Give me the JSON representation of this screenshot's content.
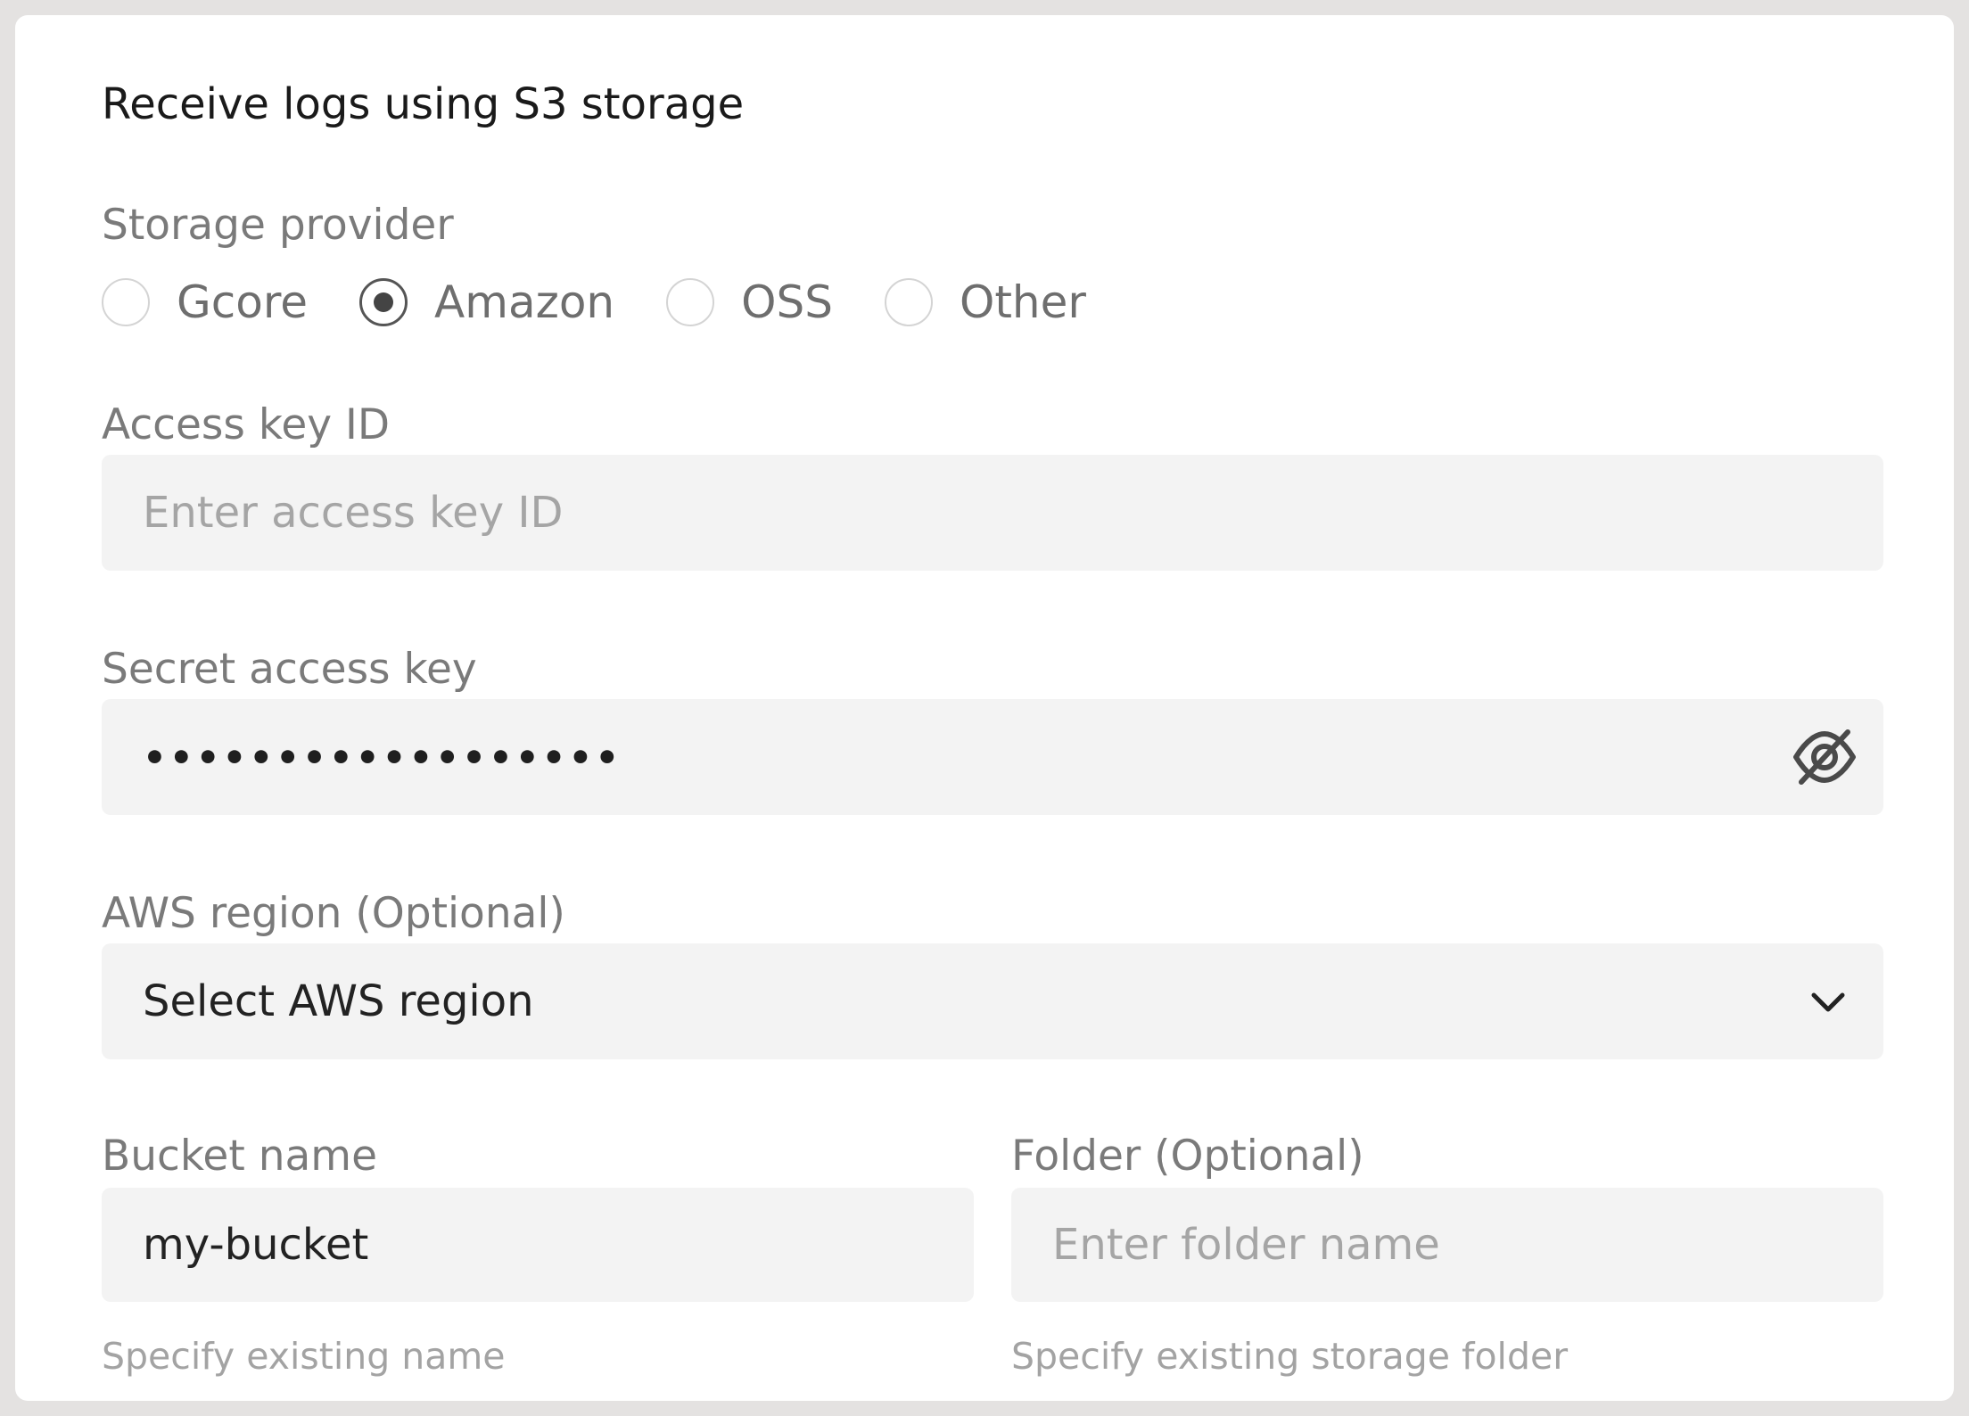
{
  "form": {
    "title": "Receive logs using S3 storage",
    "storage_provider": {
      "label": "Storage provider",
      "options": [
        {
          "label": "Gcore",
          "selected": false
        },
        {
          "label": "Amazon",
          "selected": true
        },
        {
          "label": "OSS",
          "selected": false
        },
        {
          "label": "Other",
          "selected": false
        }
      ]
    },
    "access_key_id": {
      "label": "Access key ID",
      "value": "",
      "placeholder": "Enter access key ID"
    },
    "secret_access_key": {
      "label": "Secret access key",
      "masked_value": "••••••••••••••••••",
      "visibility_icon": "eye-off-icon"
    },
    "aws_region": {
      "label": "AWS region (Optional)",
      "selected": "Select AWS region",
      "icon": "chevron-down-icon"
    },
    "bucket_name": {
      "label": "Bucket name",
      "value": "my-bucket",
      "helper": "Specify existing name"
    },
    "folder": {
      "label": "Folder (Optional)",
      "value": "",
      "placeholder": "Enter folder name",
      "helper": "Specify existing storage folder"
    }
  },
  "colors": {
    "page_background": "#e4e2e1",
    "card_background": "#ffffff",
    "field_background": "#f3f3f3",
    "label_text": "#7a7a7a",
    "helper_text": "#a3a3a3"
  }
}
